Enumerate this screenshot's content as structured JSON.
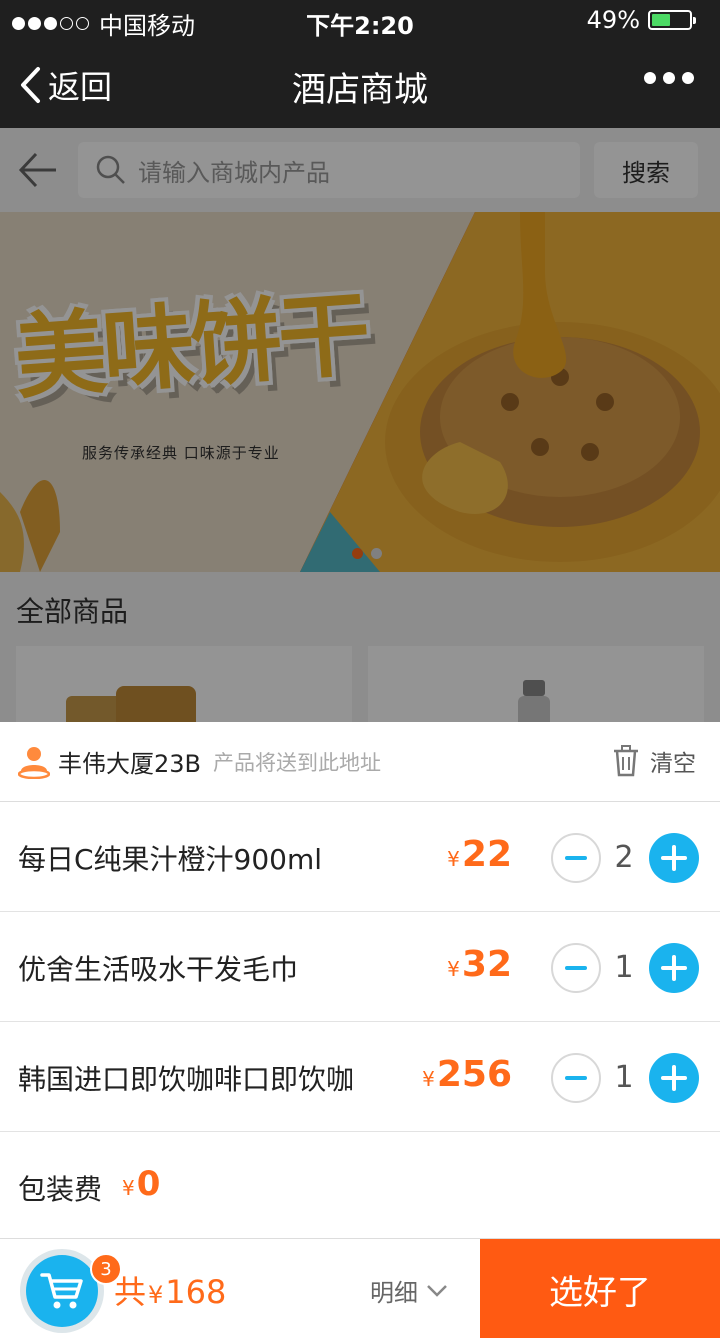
{
  "status_bar": {
    "carrier": "中国移动",
    "time": "下午2:20",
    "battery": "49%",
    "battery_level": 0.49,
    "signal_bars_filled": 3,
    "signal_bars_total": 5
  },
  "nav": {
    "back_label": "返回",
    "title": "酒店商城"
  },
  "search": {
    "placeholder": "请输入商城内产品",
    "button_label": "搜索"
  },
  "banner": {
    "title": "美味饼干",
    "subtitle": "服务传承经典 口味源于专业",
    "slide_count": 2,
    "active_slide": 0
  },
  "goods_section_title": "全部商品",
  "cart": {
    "address": "丰伟大厦23B",
    "address_tip": "产品将送到此地址",
    "clear_label": "清空",
    "currency": "¥",
    "items": [
      {
        "name": "每日C纯果汁橙汁900ml",
        "price": "22",
        "qty": "2"
      },
      {
        "name": "优舍生活吸水干发毛巾",
        "price": "32",
        "qty": "1"
      },
      {
        "name": "韩国进口即饮咖啡口即饮咖",
        "price": "256",
        "qty": "1"
      }
    ],
    "packaging_label": "包装费",
    "packaging_price": "0"
  },
  "bottom_bar": {
    "badge_count": "3",
    "total_prefix": "共",
    "total_amount": "168",
    "detail_label": "明细",
    "submit_label": "选好了"
  },
  "colors": {
    "accent_orange": "#ff6a1a",
    "accent_blue": "#1ab3ee",
    "submit_bg": "#ff5a12",
    "nav_bg": "#1f1f1f"
  }
}
